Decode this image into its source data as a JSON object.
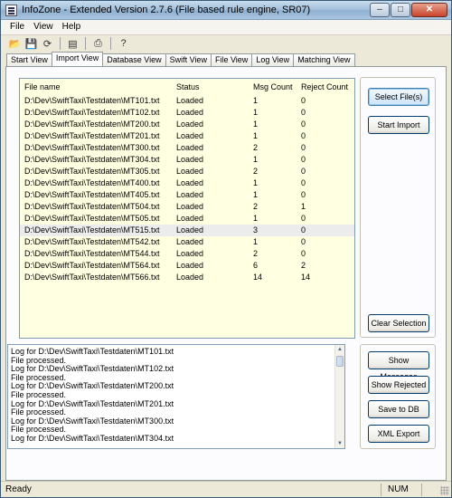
{
  "window": {
    "title": "InfoZone - Extended Version 2.7.6 (File based rule engine,  SR07)"
  },
  "menu": [
    "File",
    "View",
    "Help"
  ],
  "toolbar": [
    {
      "name": "open-folder-icon",
      "glyph": "📂"
    },
    {
      "name": "save-icon",
      "glyph": "💾"
    },
    {
      "name": "refresh-icon",
      "glyph": "⟳"
    },
    {
      "name": "tree-view-icon",
      "glyph": "▤"
    },
    {
      "name": "print-icon",
      "glyph": "⎙"
    },
    {
      "name": "help-icon",
      "glyph": "?"
    }
  ],
  "tabs": [
    "Start View",
    "Import View",
    "Database View",
    "Swift View",
    "File View",
    "Log View",
    "Matching View"
  ],
  "active_tab": "Import View",
  "file_table": {
    "columns": [
      "File name",
      "Status",
      "Msg Count",
      "Reject Count"
    ],
    "rows": [
      [
        "D:\\Dev\\SwiftTaxi\\Testdaten\\MT101.txt",
        "Loaded",
        "1",
        "0"
      ],
      [
        "D:\\Dev\\SwiftTaxi\\Testdaten\\MT102.txt",
        "Loaded",
        "1",
        "0"
      ],
      [
        "D:\\Dev\\SwiftTaxi\\Testdaten\\MT200.txt",
        "Loaded",
        "1",
        "0"
      ],
      [
        "D:\\Dev\\SwiftTaxi\\Testdaten\\MT201.txt",
        "Loaded",
        "1",
        "0"
      ],
      [
        "D:\\Dev\\SwiftTaxi\\Testdaten\\MT300.txt",
        "Loaded",
        "2",
        "0"
      ],
      [
        "D:\\Dev\\SwiftTaxi\\Testdaten\\MT304.txt",
        "Loaded",
        "1",
        "0"
      ],
      [
        "D:\\Dev\\SwiftTaxi\\Testdaten\\MT305.txt",
        "Loaded",
        "2",
        "0"
      ],
      [
        "D:\\Dev\\SwiftTaxi\\Testdaten\\MT400.txt",
        "Loaded",
        "1",
        "0"
      ],
      [
        "D:\\Dev\\SwiftTaxi\\Testdaten\\MT405.txt",
        "Loaded",
        "1",
        "0"
      ],
      [
        "D:\\Dev\\SwiftTaxi\\Testdaten\\MT504.txt",
        "Loaded",
        "2",
        "1"
      ],
      [
        "D:\\Dev\\SwiftTaxi\\Testdaten\\MT505.txt",
        "Loaded",
        "1",
        "0"
      ],
      [
        "D:\\Dev\\SwiftTaxi\\Testdaten\\MT515.txt",
        "Loaded",
        "3",
        "0"
      ],
      [
        "D:\\Dev\\SwiftTaxi\\Testdaten\\MT542.txt",
        "Loaded",
        "1",
        "0"
      ],
      [
        "D:\\Dev\\SwiftTaxi\\Testdaten\\MT544.txt",
        "Loaded",
        "2",
        "0"
      ],
      [
        "D:\\Dev\\SwiftTaxi\\Testdaten\\MT564.txt",
        "Loaded",
        "6",
        "2"
      ],
      [
        "D:\\Dev\\SwiftTaxi\\Testdaten\\MT566.txt",
        "Loaded",
        "14",
        "14"
      ]
    ],
    "selected_row": 11
  },
  "buttons": {
    "select_files": "Select File(s)",
    "start_import": "Start Import",
    "clear_selection": "Clear Selection",
    "show_messages": "Show Messages",
    "show_rejected": "Show Rejected",
    "save_to_db": "Save to DB",
    "xml_export": "XML Export"
  },
  "log_lines": [
    "Log for D:\\Dev\\SwiftTaxi\\Testdaten\\MT101.txt",
    "File processed.",
    "Log for D:\\Dev\\SwiftTaxi\\Testdaten\\MT102.txt",
    "File processed.",
    "Log for D:\\Dev\\SwiftTaxi\\Testdaten\\MT200.txt",
    "File processed.",
    "Log for D:\\Dev\\SwiftTaxi\\Testdaten\\MT201.txt",
    "File processed.",
    "Log for D:\\Dev\\SwiftTaxi\\Testdaten\\MT300.txt",
    "File processed.",
    "Log for D:\\Dev\\SwiftTaxi\\Testdaten\\MT304.txt"
  ],
  "status": {
    "text": "Ready",
    "num": "NUM"
  }
}
